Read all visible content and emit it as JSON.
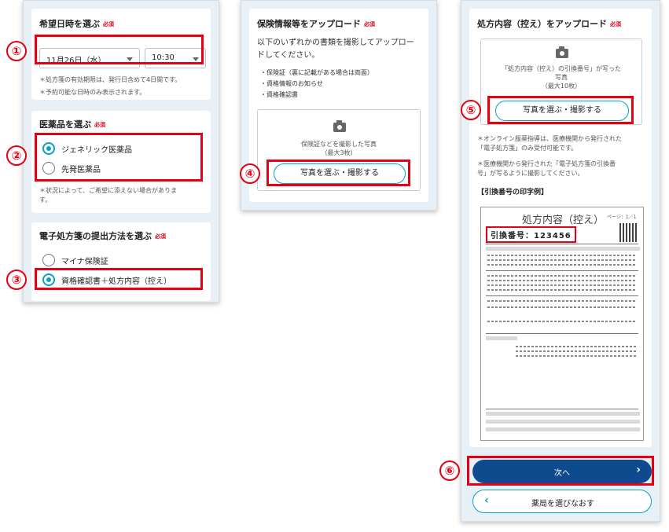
{
  "panel1": {
    "date_section": {
      "title": "希望日時を選ぶ",
      "required": "必須",
      "date_value": "11月26日（水）",
      "time_value": "10:30",
      "notes": [
        "＊処方箋の有効期限は、発行日含めて4日間です。",
        "＊予約可能な日時のみ表示されます。"
      ]
    },
    "medicine_section": {
      "title": "医薬品を選ぶ",
      "required": "必須",
      "options": [
        "ジェネリック医薬品",
        "先発医薬品"
      ],
      "selected": "ジェネリック医薬品",
      "note": "＊状況によって、ご希望に添えない場合がありま\nす。"
    },
    "submit_section": {
      "title": "電子処方箋の提出方法を選ぶ",
      "required": "必須",
      "options": [
        "マイナ保険証",
        "資格確認書＋処方内容（控え）"
      ],
      "selected": "資格確認書＋処方内容（控え）"
    }
  },
  "panel2": {
    "title": "保険情報等をアップロード",
    "required": "必須",
    "description": "以下のいずれかの書類を撮影してアップロー\nドしてください。",
    "documents": [
      "保険証（裏に記載がある場合は両面）",
      "資格情報のお知らせ",
      "資格確認書"
    ],
    "upload_hint": "保険証などを撮影した写真\n（最大3枚）",
    "upload_button": "写真を選ぶ・撮影する"
  },
  "panel3": {
    "title": "処方内容（控え）をアップロード",
    "required": "必須",
    "upload_hint": "「処方内容（控え）の引換番号」が写った\n写真\n（最大10枚）",
    "upload_button": "写真を選ぶ・撮影する",
    "notes": [
      "＊オンライン服薬指導は、医療機関から発行された\n「電子処方箋」のみ受付可能です。",
      "＊医療機関から発行された「電子処方箋の引換番\n号」が写るように撮影してください。"
    ],
    "example_label": "【引換番号の印字例】",
    "sample": {
      "title": "処方内容（控え）",
      "page": "ページ：1／1",
      "code": "引換番号：123456"
    },
    "next_button": "次へ",
    "next_chevron": "›",
    "back_button": "薬局を選びなおす",
    "back_chevron": "‹"
  },
  "markers": [
    "①",
    "②",
    "③",
    "④",
    "⑤",
    "⑥"
  ],
  "colors": {
    "accent": "#0aa0c8",
    "highlight": "#e60012",
    "primary_button": "#0d4b8e",
    "background": "#e6f0f6"
  },
  "icons": {
    "upload": "camera-icon"
  }
}
